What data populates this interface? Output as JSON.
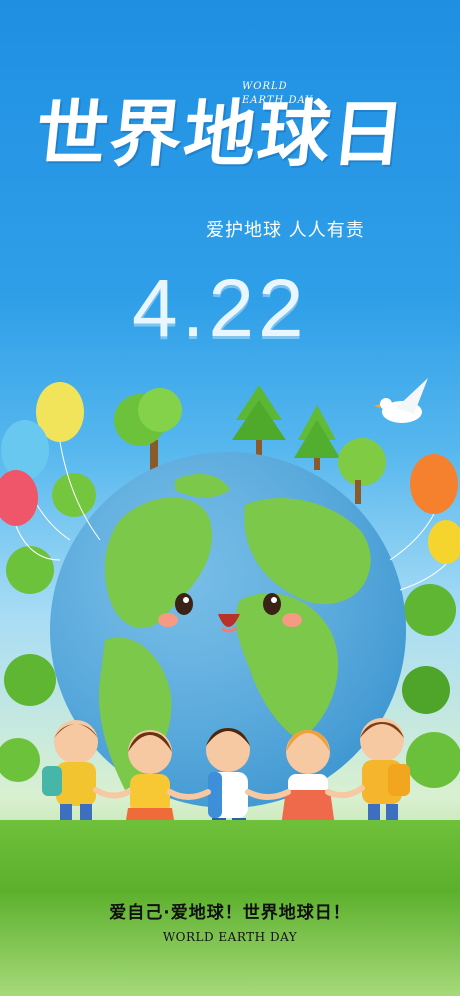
{
  "header": {
    "title": "世界地球日",
    "title_en": "WORLD\nEARTH DAY",
    "slogan": "爱护地球 人人有责",
    "date": "4.22"
  },
  "footer": {
    "slogan": "爱自己·爱地球！世界地球日！",
    "title_en": "WORLD EARTH DAY"
  },
  "colors": {
    "sky": "#2f9be6",
    "ocean": "#4aa8e0",
    "land": "#7cc84a",
    "grass": "#5cb02c"
  }
}
